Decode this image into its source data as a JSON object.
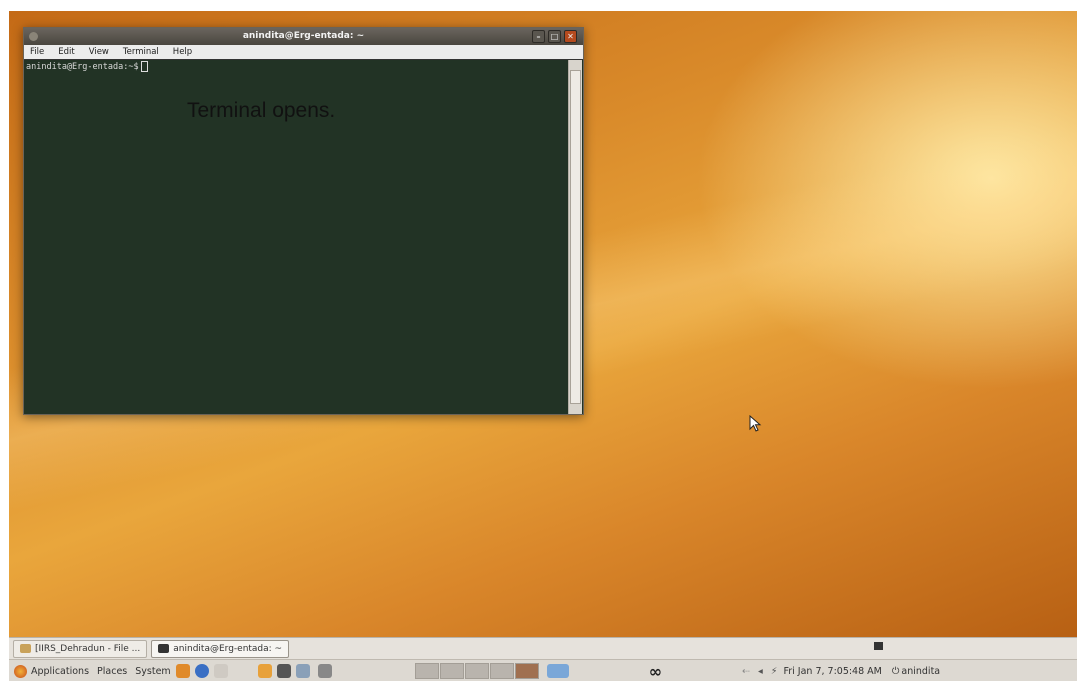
{
  "terminal": {
    "title": "anindita@Erg-entada: ~",
    "window_buttons": {
      "minimize": "–",
      "maximize": "□",
      "close": "✕"
    },
    "menu": [
      "File",
      "Edit",
      "View",
      "Terminal",
      "Help"
    ],
    "prompt": "anindita@Erg-entada:~$"
  },
  "annotation": "Terminal opens.",
  "taskbar": {
    "tasks": [
      {
        "label": "[IIRS_Dehradun - File ..."
      },
      {
        "label": "anindita@Erg-entada: ~"
      }
    ]
  },
  "panel": {
    "menus": [
      "Applications",
      "Places",
      "System"
    ],
    "infinity": "∞",
    "clock": "Fri Jan 7, 7:05:48 AM",
    "user": "anindita"
  },
  "colors": {
    "terminal_bg": "#223325",
    "panel_bg": "#ddd9d2",
    "wallpaper_accent": "#d98a2a"
  }
}
